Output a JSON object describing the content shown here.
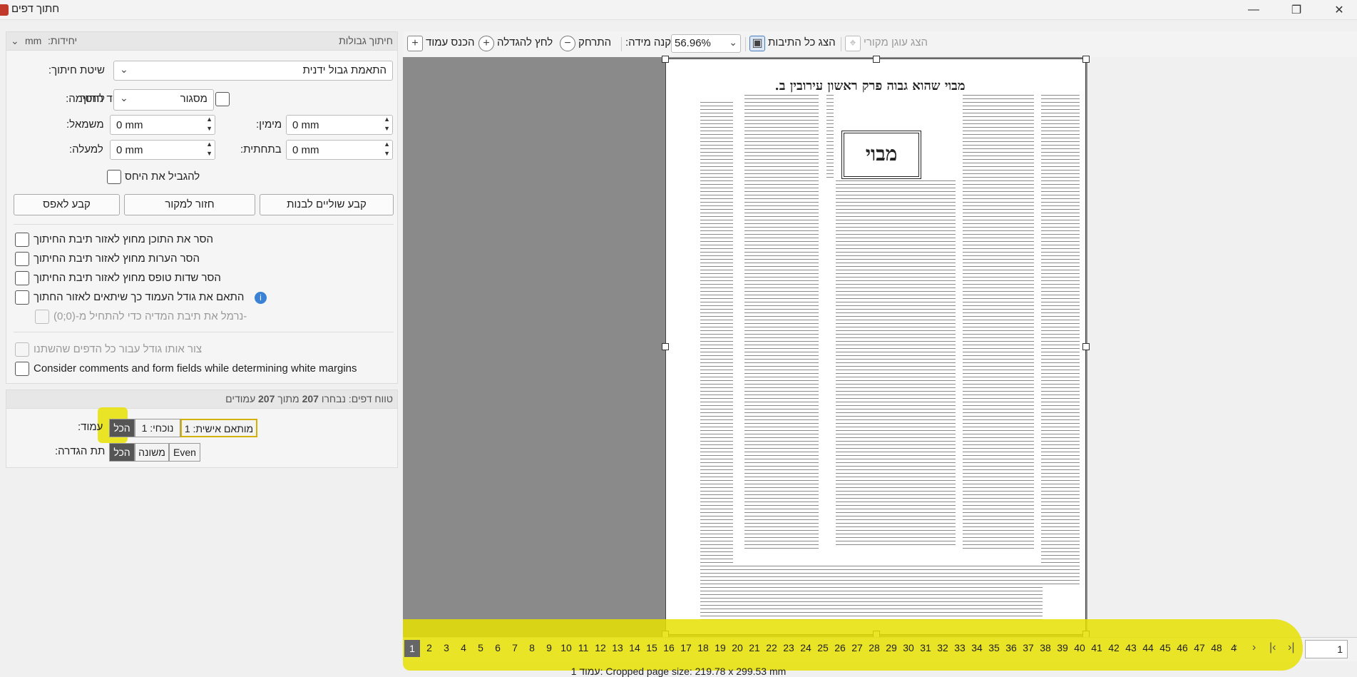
{
  "window": {
    "title": "חתוך דפים"
  },
  "crop_section": {
    "header": "חיתוך גבולות",
    "units_label": ":יחידות",
    "units_value": "mm",
    "method_label": ":שיטת חיתוך",
    "method_value": "התאמת גבול ידנית",
    "crop_box_label": ":לחסימה",
    "crop_box_value": "מסגור",
    "page_size_checkbox": "גודל עמוד חתוך",
    "left_label": ":משמאל",
    "left_value": "0 mm",
    "right_label": ":מימין",
    "right_value": "0 mm",
    "top_label": ":למעלה",
    "top_value": "0 mm",
    "bottom_label": ":בתחתית",
    "bottom_value": "0 mm",
    "constrain_label": "להגביל את היחס",
    "btn_set_white": "קבע שוליים לבנות",
    "btn_revert": "חזור למקור",
    "btn_zero": "קבע לאפס",
    "opt_remove_content": "הסר את התוכן מחוץ לאזור תיבת החיתוך",
    "opt_remove_comments": "הסר הערות מחוץ לאזור תיבת החיתוך",
    "opt_remove_fields": "הסר שדות טופס מחוץ לאזור תיבת החיתוך",
    "opt_fit_page": "התאם את גודל העמוד כך שיתאים לאזור החתוך",
    "opt_normalize": "נרמל את תיבת המדיה כדי להתחיל מ-(0;0)-",
    "opt_same_size": "צור אותו גודל עבור כל הדפים שהשתנו",
    "opt_consider": "Consider comments and form fields while determining white margins"
  },
  "range_section": {
    "header_prefix": "טווח דפים: נבחרו",
    "selected": "207",
    "header_mid": "מתוך",
    "total": "207",
    "header_suffix": "עמודים",
    "page_label": ":עמוד",
    "page_all": "הכל",
    "page_current": "נוכחי: 1",
    "page_custom": "מותאם אישית: 1",
    "subset_label": ":תת הגדרה",
    "subset_all": "הכל",
    "subset_odd": "משונה",
    "subset_even": "Even"
  },
  "toolbar": {
    "show_original": "הצג עוגן מקורי",
    "show_all_boxes": "הצג כל התיבות",
    "zoom_value": "56.96%",
    "zoom_label": ":קנה מידה",
    "zoom_out": "התרחק",
    "zoom_in": "לחץ להגדלה",
    "insert_page": "הכנס עמוד"
  },
  "document": {
    "header": "מבוי שהוא גבוה   פרק ראשון   עירובין   ב.",
    "title_box": "מבוי"
  },
  "pages": [
    "1",
    "2",
    "3",
    "4",
    "5",
    "6",
    "7",
    "8",
    "9",
    "10",
    "11",
    "12",
    "13",
    "14",
    "15",
    "16",
    "17",
    "18",
    "19",
    "20",
    "21",
    "22",
    "23",
    "24",
    "25",
    "26",
    "27",
    "28",
    "29",
    "30",
    "31",
    "32",
    "33",
    "34",
    "35",
    "36",
    "37",
    "38",
    "39",
    "40",
    "41",
    "42",
    "43",
    "44",
    "45",
    "46",
    "47",
    "48",
    "4"
  ],
  "page_input": "1",
  "status": "1 עמוד: Cropped page size: 219.78 x 299.53 mm",
  "colors": {
    "highlight": "#e6e100",
    "selected": "#555555"
  }
}
